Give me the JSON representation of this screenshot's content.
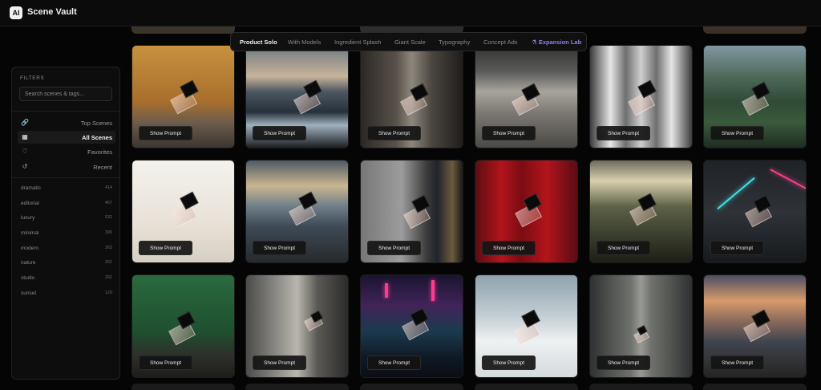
{
  "app": {
    "logo_text": "AI",
    "title": "Scene Vault"
  },
  "tabs": [
    {
      "label": "Product Solo",
      "active": true
    },
    {
      "label": "With Models"
    },
    {
      "label": "Ingredient Splash"
    },
    {
      "label": "Giant Scale"
    },
    {
      "label": "Typography"
    },
    {
      "label": "Concept Ads"
    },
    {
      "label": "Expansion Lab",
      "icon": "flask-icon",
      "accent": "#8a86e8"
    }
  ],
  "sidebar": {
    "filters_label": "FILTERS",
    "search_placeholder": "Search scenes & tags...",
    "nav": [
      {
        "label": "Top Scenes",
        "icon": "fire-icon"
      },
      {
        "label": "All Scenes",
        "icon": "grid-icon",
        "active": true
      },
      {
        "label": "Favorites",
        "icon": "heart-icon"
      },
      {
        "label": "Recent",
        "icon": "history-icon"
      }
    ],
    "tags": [
      {
        "name": "dramatic",
        "count": "414"
      },
      {
        "name": "editorial",
        "count": "467"
      },
      {
        "name": "luxury",
        "count": "532"
      },
      {
        "name": "minimal",
        "count": "399"
      },
      {
        "name": "modern",
        "count": "263"
      },
      {
        "name": "nature",
        "count": "252"
      },
      {
        "name": "studio",
        "count": "262"
      },
      {
        "name": "sunset",
        "count": "129"
      }
    ]
  },
  "card_button_label": "Show Prompt"
}
